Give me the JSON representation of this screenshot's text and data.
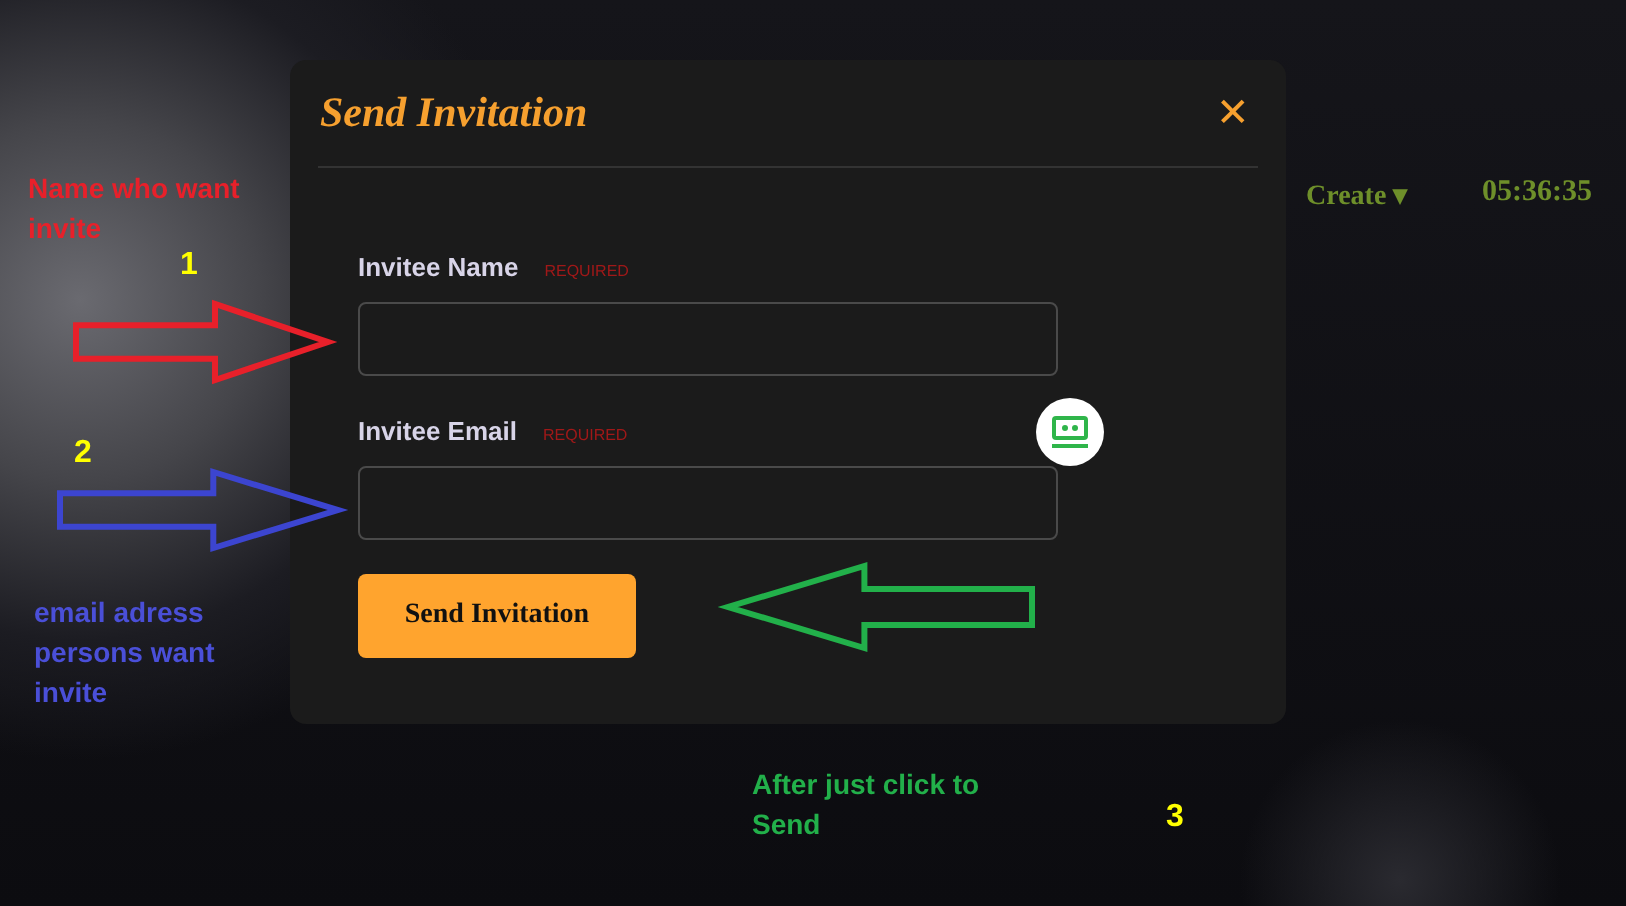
{
  "background": {
    "menu": "Create ▾",
    "clock": "05:36:35"
  },
  "dialog": {
    "title": "Send Invitation",
    "close": "✕",
    "fields": [
      {
        "label": "Invitee Name",
        "tag": "REQUIRED"
      },
      {
        "label": "Invitee Email",
        "tag": "REQUIRED"
      }
    ],
    "submit": "Send Invitation"
  },
  "annotations": [
    {
      "kind": "note",
      "text": "Name who want invite",
      "color": "#e8202a"
    },
    {
      "kind": "number",
      "text": "1",
      "color": "#ffff00"
    },
    {
      "kind": "right-arrow",
      "color": "#e8202a"
    },
    {
      "kind": "number",
      "text": "2",
      "color": "#ffff00"
    },
    {
      "kind": "right-arrow",
      "color": "#3c45d0"
    },
    {
      "kind": "note",
      "text": "email adress persons want invite",
      "color": "#4a4fd8"
    },
    {
      "kind": "left-arrow",
      "color": "#22b04a"
    },
    {
      "kind": "note",
      "text": "After just click to Send",
      "color": "#22b04a"
    },
    {
      "kind": "number",
      "text": "3",
      "color": "#ffff00"
    }
  ]
}
